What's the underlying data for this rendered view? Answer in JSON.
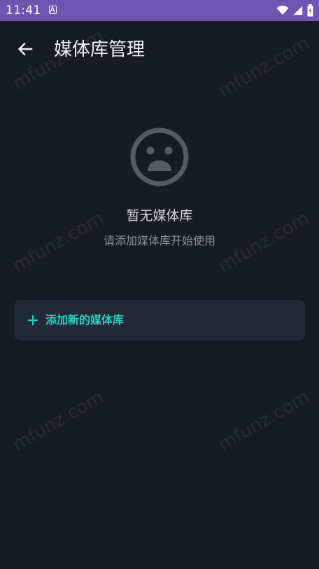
{
  "status_bar": {
    "time": "11:41",
    "color": "#6d55b2"
  },
  "header": {
    "title": "媒体库管理",
    "back_icon": "arrow-left-icon"
  },
  "empty_state": {
    "icon": "sad-face-icon",
    "title": "暂无媒体库",
    "subtitle": "请添加媒体库开始使用"
  },
  "add_button": {
    "icon": "plus-icon",
    "label": "添加新的媒体库",
    "accent": "#27d0c0"
  },
  "watermark": "mfunz.com"
}
